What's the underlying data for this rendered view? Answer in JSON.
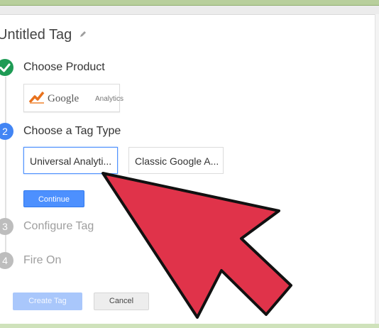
{
  "page": {
    "title": "Untitled Tag",
    "edit_icon": "pencil-icon"
  },
  "steps": [
    {
      "number": "",
      "label": "Choose Product",
      "state": "complete",
      "icon": "check-icon"
    },
    {
      "number": "2",
      "label": "Choose a Tag Type",
      "state": "active"
    },
    {
      "number": "3",
      "label": "Configure Tag",
      "state": "disabled"
    },
    {
      "number": "4",
      "label": "Fire On",
      "state": "disabled"
    }
  ],
  "product": {
    "brand": "Google",
    "sub": "Analytics",
    "icon": "google-analytics-logo-icon"
  },
  "tag_types": [
    {
      "label": "Universal Analyti...",
      "selected": true
    },
    {
      "label": "Classic Google A...",
      "selected": false
    }
  ],
  "buttons": {
    "continue": "Continue",
    "create_tag": "Create Tag",
    "cancel": "Cancel"
  },
  "overlay": {
    "icon": "red-pointer-arrow-icon",
    "color": "#e0334a"
  },
  "colors": {
    "complete": "#1e9b55",
    "active": "#4285f4",
    "disabled": "#bdbdbd",
    "primary_button": "#4d90fe"
  }
}
